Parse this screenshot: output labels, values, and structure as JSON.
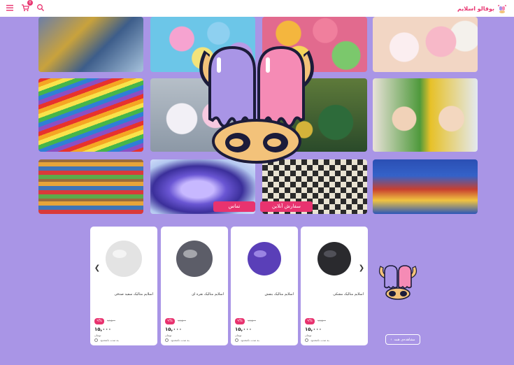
{
  "header": {
    "brand_name": "بوفالو اسلایم",
    "logo_icon": "cow-logo-icon",
    "cart_count": "0",
    "icons": [
      "menu-icon",
      "cart-icon",
      "search-icon"
    ]
  },
  "hero": {
    "tiles": [
      "playmobil-toy-store-image",
      "squishy-cats-image",
      "stress-balls-image",
      "squishy-animals-image",
      "rainbow-dominoes-image",
      "unicorn-figures-image",
      "board-game-pieces-image",
      "kids-building-blocks-image",
      "toy-shelves-image",
      "purple-slime-image",
      "board-games-image",
      "toy-shop-interior-image"
    ],
    "center_logo": "cow-mascot-logo",
    "online_order_label": "سفارش آنلاین",
    "contact_label": "تماس"
  },
  "products": [
    {
      "title": "اسلایم متالیک مشکی",
      "discount": "۹%",
      "old_price": "۱۶,۵۰۰",
      "price": "۱۵,۰۰۰",
      "currency": "تومان",
      "availability": "به مدت نامحدود",
      "slime_color": "#2a2a2e"
    },
    {
      "title": "اسلایم متالیک بنفش",
      "discount": "۹%",
      "old_price": "۱۶,۵۰۰",
      "price": "۱۵,۰۰۰",
      "currency": "تومان",
      "availability": "به مدت نامحدود",
      "slime_color": "#5a3fb8"
    },
    {
      "title": "اسلایم متالیک نقره ای",
      "discount": "۹%",
      "old_price": "۱۶,۵۰۰",
      "price": "۱۵,۰۰۰",
      "currency": "تومان",
      "availability": "به مدت نامحدود",
      "slime_color": "#5c5d68"
    },
    {
      "title": "اسلایم متالیک سفید صدفی",
      "discount": "۹%",
      "old_price": "۱۶,۵۰۰",
      "price": "۱۵,۰۰۰",
      "currency": "تومان",
      "availability": "به مدت نامحدود",
      "slime_color": "#e3e3e3"
    }
  ],
  "carousel": {
    "prev_icon": "chevron-left-icon",
    "next_icon": "chevron-right-icon",
    "view_all_label": "مشاهده‌ی همه"
  },
  "colors": {
    "background": "#a995e6",
    "accent": "#e8336f"
  }
}
